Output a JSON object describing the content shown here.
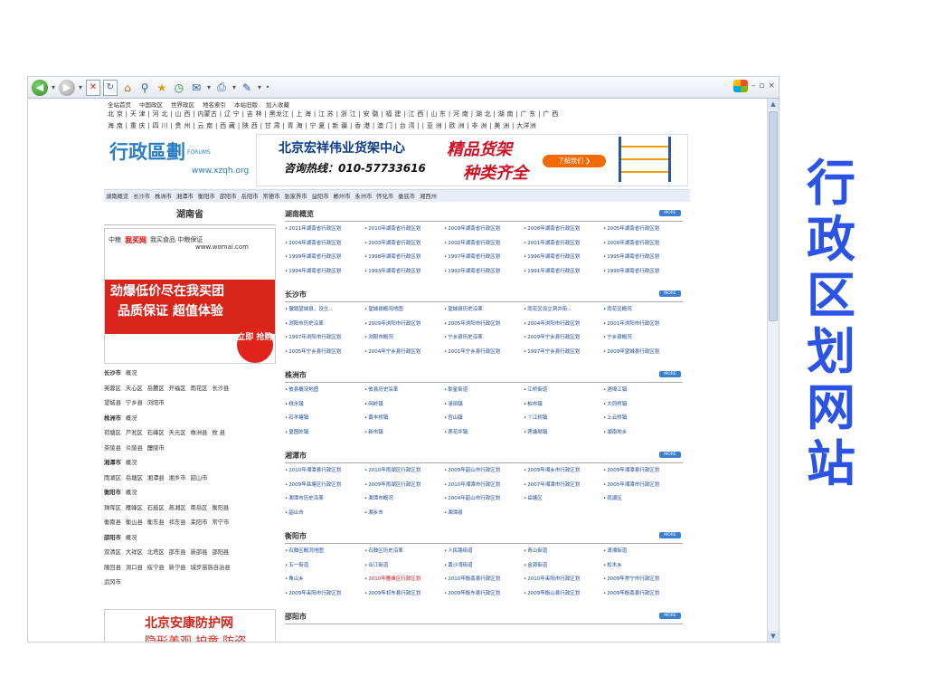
{
  "slide_title": [
    "行",
    "政",
    "区",
    "划",
    "网",
    "站"
  ],
  "toolbar": {
    "back": "◀",
    "forward": "▶",
    "stop": "✕",
    "refresh": "↻",
    "home": "⌂",
    "search": "⚲",
    "fav": "★",
    "history": "◷",
    "mail": "✉",
    "print": "⎙",
    "edit": "✎",
    "menu": "•"
  },
  "window": {
    "min": "–",
    "max": "▫",
    "close": "×"
  },
  "topnav": [
    "全站首页",
    "中国政区",
    "世界政区",
    "地名索引",
    "本站旧版",
    "加入收藏"
  ],
  "regions": {
    "row1": "北 京 | 天 津 | 河 北 | 山 西 | 内蒙古 | 辽 宁 | 吉 林 | 黑龙江 | 上 海 | 江 苏 | 浙 江 | 安 徽 | 福 建 | 江 西 | 山 东 | 河 南 | 湖 北 | 湖 南 | 广 东 | 广 西",
    "row2": "海 南 | 重 庆 | 四 川 | 贵 州 | 云 南 | 西 藏 | 陕 西 | 甘 肃 | 青 海 | 宁 夏 | 新 疆 | 香 港 | 澳 门 | 台 湾 |     | 亚 洲 | 欧 洲 | 非 洲 | 美 洲 | 大洋洲"
  },
  "logo": {
    "name": "行政區劃",
    "forums": "FORUMS",
    "url": "www.xzqh.org"
  },
  "ad": {
    "company": "北京宏祥伟业货架中心",
    "tel": "咨询热线：010-57733616",
    "slogan1": "精品货架",
    "slogan2": "种类齐全",
    "button": "了解我们 ❯"
  },
  "citynav": [
    "湖南概览",
    "长沙市",
    "株洲市",
    "湘潭市",
    "衡阳市",
    "邵阳市",
    "岳阳市",
    "常德市",
    "张家界市",
    "益阳市",
    "郴州市",
    "永州市",
    "怀化市",
    "娄底市",
    "湘西州"
  ],
  "left": {
    "title": "湖南省",
    "ad": {
      "brand1": "中粮",
      "brand2": "我买网",
      "tag": "我买食品 中粮保证",
      "url": "www.womai.com",
      "line1": "劲爆低价尽在我买团",
      "line2": "品质保证 超值体验",
      "badge": "立即 抢购"
    },
    "list": [
      {
        "h": "长沙市",
        "sub": "概况"
      },
      {
        "items": [
          "芙蓉区",
          "天心区",
          "岳麓区",
          "开福区",
          "雨花区",
          "长沙县"
        ]
      },
      {
        "items": [
          "望城县",
          "宁乡县",
          "浏阳市"
        ]
      },
      {
        "h": "株洲市",
        "sub": "概况"
      },
      {
        "items": [
          "荷塘区",
          "芦淞区",
          "石峰区",
          "天元区",
          "株洲县",
          "攸 县"
        ]
      },
      {
        "items": [
          "茶陵县",
          "炎陵县",
          "醴陵市"
        ]
      },
      {
        "h": "湘潭市",
        "sub": "概况"
      },
      {
        "items": [
          "雨湖区",
          "岳塘区",
          "湘潭县",
          "湘乡市",
          "韶山市"
        ]
      },
      {
        "h": "衡阳市",
        "sub": "概况"
      },
      {
        "items": [
          "珠晖区",
          "雁峰区",
          "石鼓区",
          "蒸湘区",
          "南岳区",
          "衡阳县"
        ]
      },
      {
        "items": [
          "衡南县",
          "衡山县",
          "衡东县",
          "祁东县",
          "耒阳市",
          "常宁市"
        ]
      },
      {
        "h": "邵阳市",
        "sub": "概况"
      },
      {
        "items": [
          "双清区",
          "大祥区",
          "北塔区",
          "邵东县",
          "新邵县",
          "邵阳县"
        ]
      },
      {
        "items": [
          "隆回县",
          "洞口县",
          "绥宁县",
          "新宁县",
          "城步苗族自治县"
        ]
      },
      {
        "items": [
          "武冈市"
        ]
      }
    ],
    "bottom_ad": {
      "t1": "北京安康防护网",
      "t2": "隐形美观 护童 防盗"
    }
  },
  "sections": [
    {
      "title": "湖南概览",
      "more": "MORE",
      "links": [
        "2011年湖南省行政区划",
        "2010年湖南省行政区划",
        "2009年湖南省行政区划",
        "2008年湖南省行政区划",
        "2005年湖南省行政区划",
        "2004年湖南省行政区划",
        "2003年湖南省行政区划",
        "2002年湖南省行政区划",
        "2001年湖南省行政区划",
        "2000年湖南省行政区划",
        "1999年湖南省行政区划",
        "1998年湖南省行政区划",
        "1997年湖南省行政区划",
        "1996年湖南省行政区划",
        "1995年湖南省行政区划",
        "1994年湖南省行政区划",
        "1993年湖南省行政区划",
        "1992年湖南省行政区划",
        "1991年湖南省行政区划",
        "1990年湖南省行政区划"
      ]
    },
    {
      "title": "长沙市",
      "more": "MORE",
      "links": [
        "撤销望城县，设立...",
        "望城县概况地图",
        "望城县历史沿革",
        "雨花区设立洞井街...",
        "雨花区概况",
        "浏阳市历史沿革",
        "2009年浏阳市行政区划",
        "2005年浏阳市行政区划",
        "2004年浏阳市行政区划",
        "2001年浏阳市行政区划",
        "1997年浏阳市行政区划",
        "浏阳市概况",
        "宁乡县历史沿革",
        "2009年宁乡县行政区划",
        "宁乡县概况",
        "2005年宁乡县行政区划",
        "2004年宁乡县行政区划",
        "2001年宁乡县行政区划",
        "1997年宁乡县行政区划",
        "2009年望城县行政区划"
      ]
    },
    {
      "title": "株洲市",
      "more": "MORE",
      "links": [
        "攸县概况地图",
        "攸县历史沿革",
        "耿星街道",
        "江桥街道",
        "酒埠江镇",
        "桃水镇",
        "网岭镇",
        "渌田镇",
        "柏市镇",
        "大同桥镇",
        "石羊塘镇",
        "黄丰桥镇",
        "宫山镇",
        "丫江桥镇",
        "上云桥镇",
        "皇图岭镇",
        "新市镇",
        "莲花坪镇",
        "莲塘坳镇",
        "湖南地乡"
      ]
    },
    {
      "title": "湘潭市",
      "more": "MORE",
      "links": [
        "2010年湘潭县行政区划",
        "2010年雨湖区行政区划",
        "2009年韶山市行政区划",
        "2009年湘乡市行政区划",
        "2009年湘潭县行政区划",
        "2009年岳塘区行政区划",
        "2009年雨湖区行政区划",
        "2010年湘潭市行政区划",
        "2007年湘潭市行政区划",
        "2005年湘潭市行政区划",
        "湘潭市历史沿革",
        "湘潭市概况",
        "2004年韶山市行政区划",
        "岳塘区",
        "雨湖区",
        "韶山市",
        "湘乡市",
        "湘潭县"
      ]
    },
    {
      "title": "衡阳市",
      "more": "MORE",
      "links": [
        "石鼓区概况地图",
        "石鼓区历史沿革",
        "人民路街道",
        "青山街道",
        "潇湘街道",
        "五一街道",
        "合江街道",
        "黄沙湾街道",
        "金源街道",
        "松木乡",
        "角山乡",
        "2010年雁峰区行政区划",
        "2010年衡南县行政区划",
        "2010年耒阳市行政区划",
        "2009年常宁市行政区划",
        "2009年耒阳市行政区划",
        "2009年祁东县行政区划",
        "2009年衡东县行政区划",
        "2009年衡山县行政区划",
        "2009年衡南县行政区划"
      ],
      "red": [
        11
      ]
    },
    {
      "title": "邵阳市",
      "more": "MORE",
      "links": []
    }
  ]
}
